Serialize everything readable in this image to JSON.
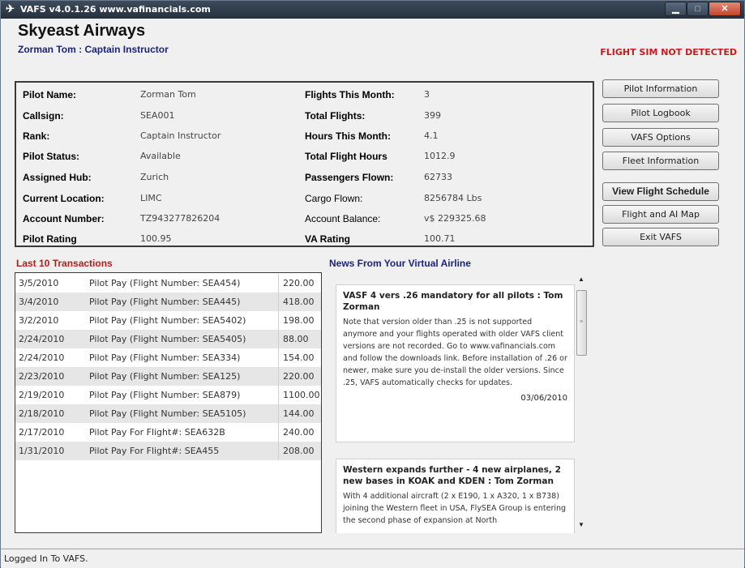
{
  "window": {
    "title": "VAFS v4.0.1.26 www.vafinancials.com",
    "app_icon": "airplane-icon"
  },
  "header": {
    "airline_name": "Skyeast Airways",
    "pilot_subtitle": "Zorman Tom : Captain Instructor",
    "sim_status": "FLIGHT SIM NOT DETECTED"
  },
  "pilot_info": {
    "pilot_name": {
      "label": "Pilot Name:",
      "value": "Zorman Tom"
    },
    "callsign": {
      "label": "Callsign:",
      "value": "SEA001"
    },
    "rank": {
      "label": "Rank:",
      "value": "Captain Instructor"
    },
    "pilot_status": {
      "label": "Pilot Status:",
      "value": "Available"
    },
    "assigned_hub": {
      "label": "Assigned Hub:",
      "value": "Zurich"
    },
    "current_location": {
      "label": "Current Location:",
      "value": "LIMC"
    },
    "account_number": {
      "label": "Account Number:",
      "value": "TZ943277826204"
    },
    "pilot_rating": {
      "label": "Pilot Rating",
      "value": "100.95"
    },
    "flights_this_month": {
      "label": "Flights This Month:",
      "value": "3"
    },
    "total_flights": {
      "label": "Total Flights:",
      "value": "399"
    },
    "hours_this_month": {
      "label": "Hours This Month:",
      "value": "4.1"
    },
    "total_flight_hours": {
      "label": "Total Flight Hours",
      "value": "1012.9"
    },
    "passengers_flown": {
      "label": "Passengers Flown:",
      "value": "62733"
    },
    "cargo_flown": {
      "label": "Cargo Flown:",
      "value": "8256784 Lbs"
    },
    "account_balance": {
      "label": "Account Balance:",
      "value": "v$ 229325.68"
    },
    "va_rating": {
      "label": "VA Rating",
      "value": "100.71"
    }
  },
  "buttons": {
    "pilot_information": "Pilot Information",
    "pilot_logbook": "Pilot Logbook",
    "vafs_options": "VAFS Options",
    "fleet_information": "Fleet Information",
    "view_flight_schedule": "View Flight Schedule",
    "flight_and_ai_map": "Flight and AI Map",
    "exit_vafs": "Exit VAFS"
  },
  "transactions": {
    "title": "Last 10 Transactions",
    "rows": [
      {
        "date": "3/5/2010",
        "desc": "Pilot Pay (Flight Number: SEA454)",
        "amount": "220.00"
      },
      {
        "date": "3/4/2010",
        "desc": "Pilot Pay (Flight Number: SEA445)",
        "amount": "418.00"
      },
      {
        "date": "3/2/2010",
        "desc": "Pilot Pay (Flight Number: SEA5402)",
        "amount": "198.00"
      },
      {
        "date": "2/24/2010",
        "desc": "Pilot Pay (Flight Number: SEA5405)",
        "amount": "88.00"
      },
      {
        "date": "2/24/2010",
        "desc": "Pilot Pay (Flight Number: SEA334)",
        "amount": "154.00"
      },
      {
        "date": "2/23/2010",
        "desc": "Pilot Pay (Flight Number: SEA125)",
        "amount": "220.00"
      },
      {
        "date": "2/19/2010",
        "desc": "Pilot Pay (Flight Number: SEA879)",
        "amount": "1100.00"
      },
      {
        "date": "2/18/2010",
        "desc": "Pilot Pay (Flight Number: SEA5105)",
        "amount": "144.00"
      },
      {
        "date": "2/17/2010",
        "desc": "Pilot Pay For Flight#: SEA632B",
        "amount": "240.00"
      },
      {
        "date": "1/31/2010",
        "desc": "Pilot Pay For Flight#: SEA455",
        "amount": "208.00"
      }
    ]
  },
  "news": {
    "title": "News From Your Virtual Airline",
    "items": [
      {
        "headline": "VASF 4 vers .26 mandatory for all pilots : Tom Zorman",
        "body": "Note that version older than .25 is not supported anymore and your flights operated with older VAFS client versions are not recorded. Go to www.vafinancials.com and follow the downloads link. Before installation of .26 or newer, make sure you de-install the older versions. Since .25, VAFS automatically checks for updates.",
        "date": "03/06/2010"
      },
      {
        "headline": "Western expands further - 4 new airplanes, 2 new bases in KOAK and KDEN : Tom Zorman",
        "body": "With 4 additional aircraft (2 x E190, 1 x A320, 1 x B738) joining the Western fleet in USA, FlySEA Group is entering the second phase of expansion at North",
        "date": ""
      }
    ]
  },
  "status_bar": {
    "text": "Logged In To VAFS."
  }
}
